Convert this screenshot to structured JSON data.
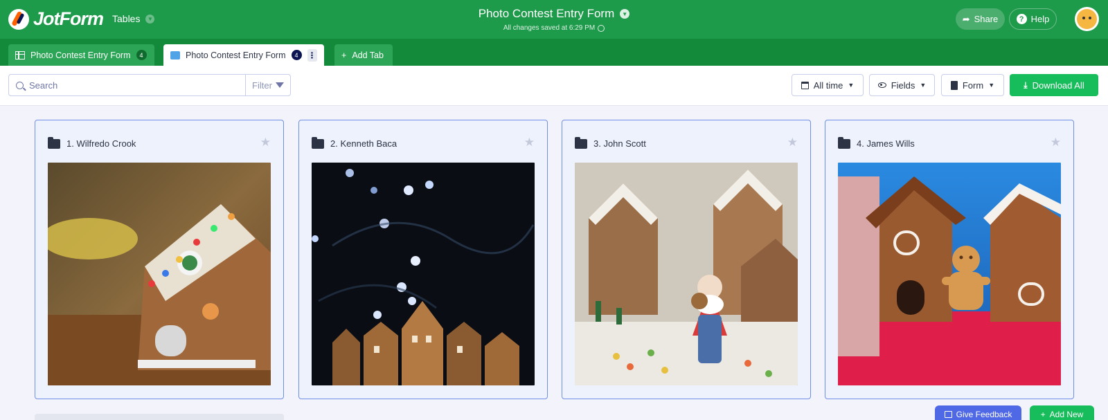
{
  "header": {
    "logo_text": "JotForm",
    "tables_label": "Tables",
    "form_title": "Photo Contest Entry Form",
    "save_status": "All changes saved at 6:29 PM",
    "share_label": "Share",
    "help_label": "Help"
  },
  "tabs": [
    {
      "label": "Photo Contest Entry Form",
      "count": "4",
      "icon": "grid-icon",
      "active": false
    },
    {
      "label": "Photo Contest Entry Form",
      "count": "4",
      "icon": "folder-icon",
      "active": true
    }
  ],
  "add_tab_label": "Add Tab",
  "toolbar": {
    "search_placeholder": "Search",
    "filter_label": "Filter",
    "time_label": "All time",
    "fields_label": "Fields",
    "form_label": "Form",
    "download_label": "Download All"
  },
  "cards": [
    {
      "title": "1. Wilfredo Crook"
    },
    {
      "title": "2. Kenneth Baca"
    },
    {
      "title": "3. John Scott"
    },
    {
      "title": "4. James Wills"
    }
  ],
  "footer": {
    "feedback_label": "Give Feedback",
    "add_new_label": "Add New"
  },
  "colors": {
    "header_green": "#1e9a4b",
    "tabbar_green": "#138a3a",
    "accent_green": "#18bd5b",
    "card_border": "#6f8fe6",
    "feedback_blue": "#4f68e6"
  }
}
